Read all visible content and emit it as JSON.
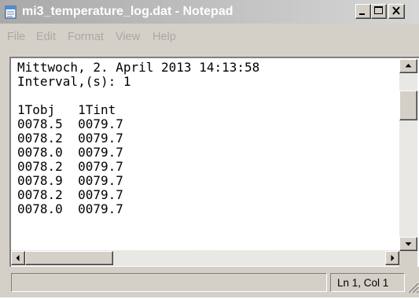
{
  "window": {
    "title": "mi3_temperature_log.dat - Notepad",
    "icon": "notepad-icon",
    "controls": [
      "minimize-icon",
      "maximize-icon",
      "close-icon"
    ]
  },
  "menu": {
    "items": [
      "File",
      "Edit",
      "Format",
      "View",
      "Help"
    ]
  },
  "document": {
    "lines": [
      "Mittwoch, 2. April 2013 14:13:58",
      "Interval,(s): 1",
      "",
      "1Tobj   1Tint",
      "0078.5  0079.7",
      "0078.2  0079.7",
      "0078.0  0079.7",
      "0078.2  0079.7",
      "0078.9  0079.7",
      "0078.2  0079.7",
      "0078.0  0079.7"
    ]
  },
  "statusbar": {
    "position": "Ln 1, Col 1"
  },
  "colors": {
    "titlebar": "#a9a9a9",
    "chrome": "#d4d0c8",
    "menu_text": "#a8a8a8"
  }
}
